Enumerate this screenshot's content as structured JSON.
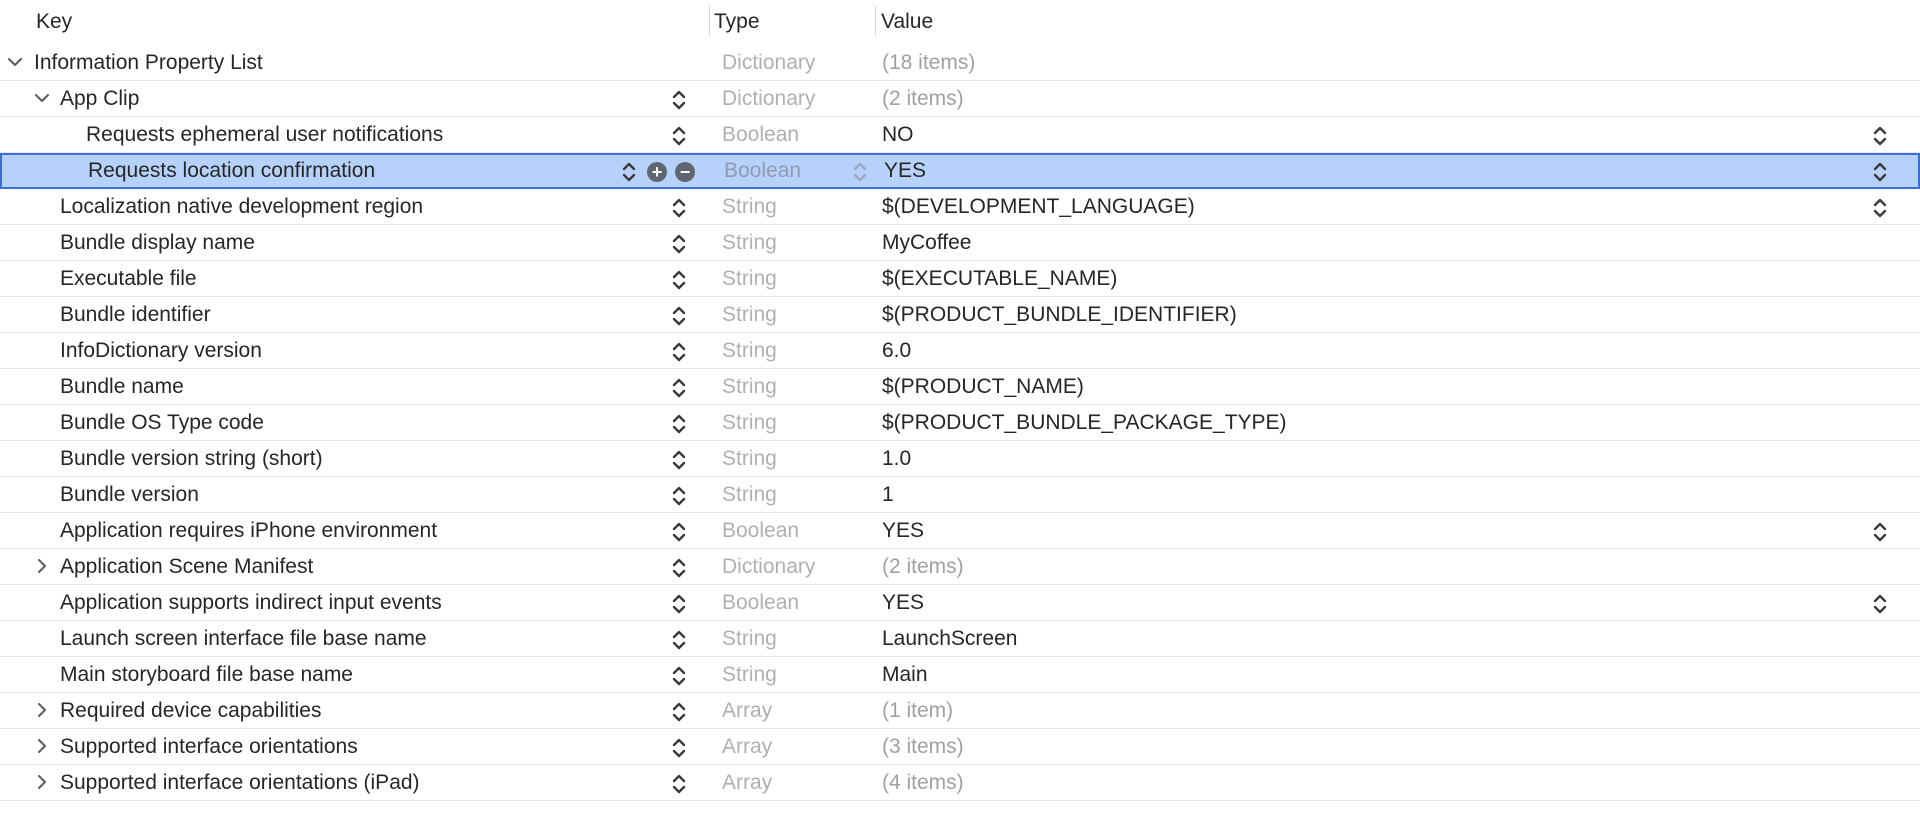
{
  "header": {
    "key_label": "Key",
    "type_label": "Type",
    "value_label": "Value"
  },
  "rows": [
    {
      "key": "Information Property List",
      "type": "Dictionary",
      "value": "(18 items)"
    },
    {
      "key": "App Clip",
      "type": "Dictionary",
      "value": "(2 items)"
    },
    {
      "key": "Requests ephemeral user notifications",
      "type": "Boolean",
      "value": "NO"
    },
    {
      "key": "Requests location confirmation",
      "type": "Boolean",
      "value": "YES"
    },
    {
      "key": "Localization native development region",
      "type": "String",
      "value": "$(DEVELOPMENT_LANGUAGE)"
    },
    {
      "key": "Bundle display name",
      "type": "String",
      "value": "MyCoffee"
    },
    {
      "key": "Executable file",
      "type": "String",
      "value": "$(EXECUTABLE_NAME)"
    },
    {
      "key": "Bundle identifier",
      "type": "String",
      "value": "$(PRODUCT_BUNDLE_IDENTIFIER)"
    },
    {
      "key": "InfoDictionary version",
      "type": "String",
      "value": "6.0"
    },
    {
      "key": "Bundle name",
      "type": "String",
      "value": "$(PRODUCT_NAME)"
    },
    {
      "key": "Bundle OS Type code",
      "type": "String",
      "value": "$(PRODUCT_BUNDLE_PACKAGE_TYPE)"
    },
    {
      "key": "Bundle version string (short)",
      "type": "String",
      "value": "1.0"
    },
    {
      "key": "Bundle version",
      "type": "String",
      "value": "1"
    },
    {
      "key": "Application requires iPhone environment",
      "type": "Boolean",
      "value": "YES"
    },
    {
      "key": "Application Scene Manifest",
      "type": "Dictionary",
      "value": "(2 items)"
    },
    {
      "key": "Application supports indirect input events",
      "type": "Boolean",
      "value": "YES"
    },
    {
      "key": "Launch screen interface file base name",
      "type": "String",
      "value": "LaunchScreen"
    },
    {
      "key": "Main storyboard file base name",
      "type": "String",
      "value": "Main"
    },
    {
      "key": "Required device capabilities",
      "type": "Array",
      "value": "(1 item)"
    },
    {
      "key": "Supported interface orientations",
      "type": "Array",
      "value": "(3 items)"
    },
    {
      "key": "Supported interface orientations (iPad)",
      "type": "Array",
      "value": "(4 items)"
    }
  ],
  "icons": {
    "expand": "chevron-down-icon",
    "collapse": "chevron-right-icon",
    "stepper": "up-down-stepper-icon",
    "add": "plus-circle-icon",
    "remove": "minus-circle-icon"
  },
  "colors": {
    "selection_bg": "#b7d2fa",
    "selection_border": "#3b6fd6",
    "type_text": "#b0b0b0",
    "muted_value": "#a0a0a0"
  }
}
